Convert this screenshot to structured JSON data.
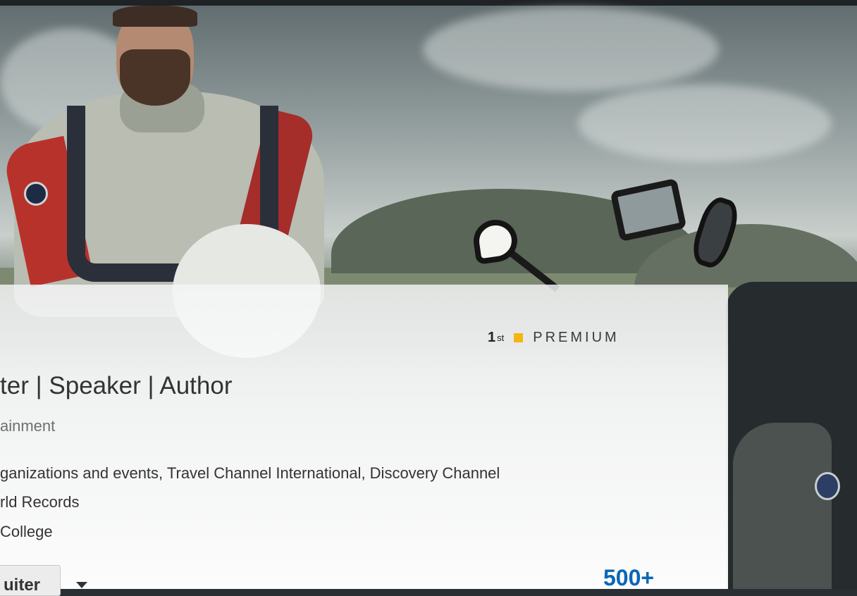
{
  "profile": {
    "degree": "1",
    "degree_suffix": "st",
    "premium_label": "PREMIUM",
    "headline": "ter | Speaker | Author",
    "industry": "ainment",
    "current": "ganizations and events, Travel Channel International, Discovery Channel",
    "previous": "rld Records",
    "education": "College",
    "connections": "500+"
  },
  "actions": {
    "primary_label": "uiter"
  },
  "colors": {
    "premium_accent": "#f5b60f",
    "connections_blue": "#0a66b7"
  }
}
